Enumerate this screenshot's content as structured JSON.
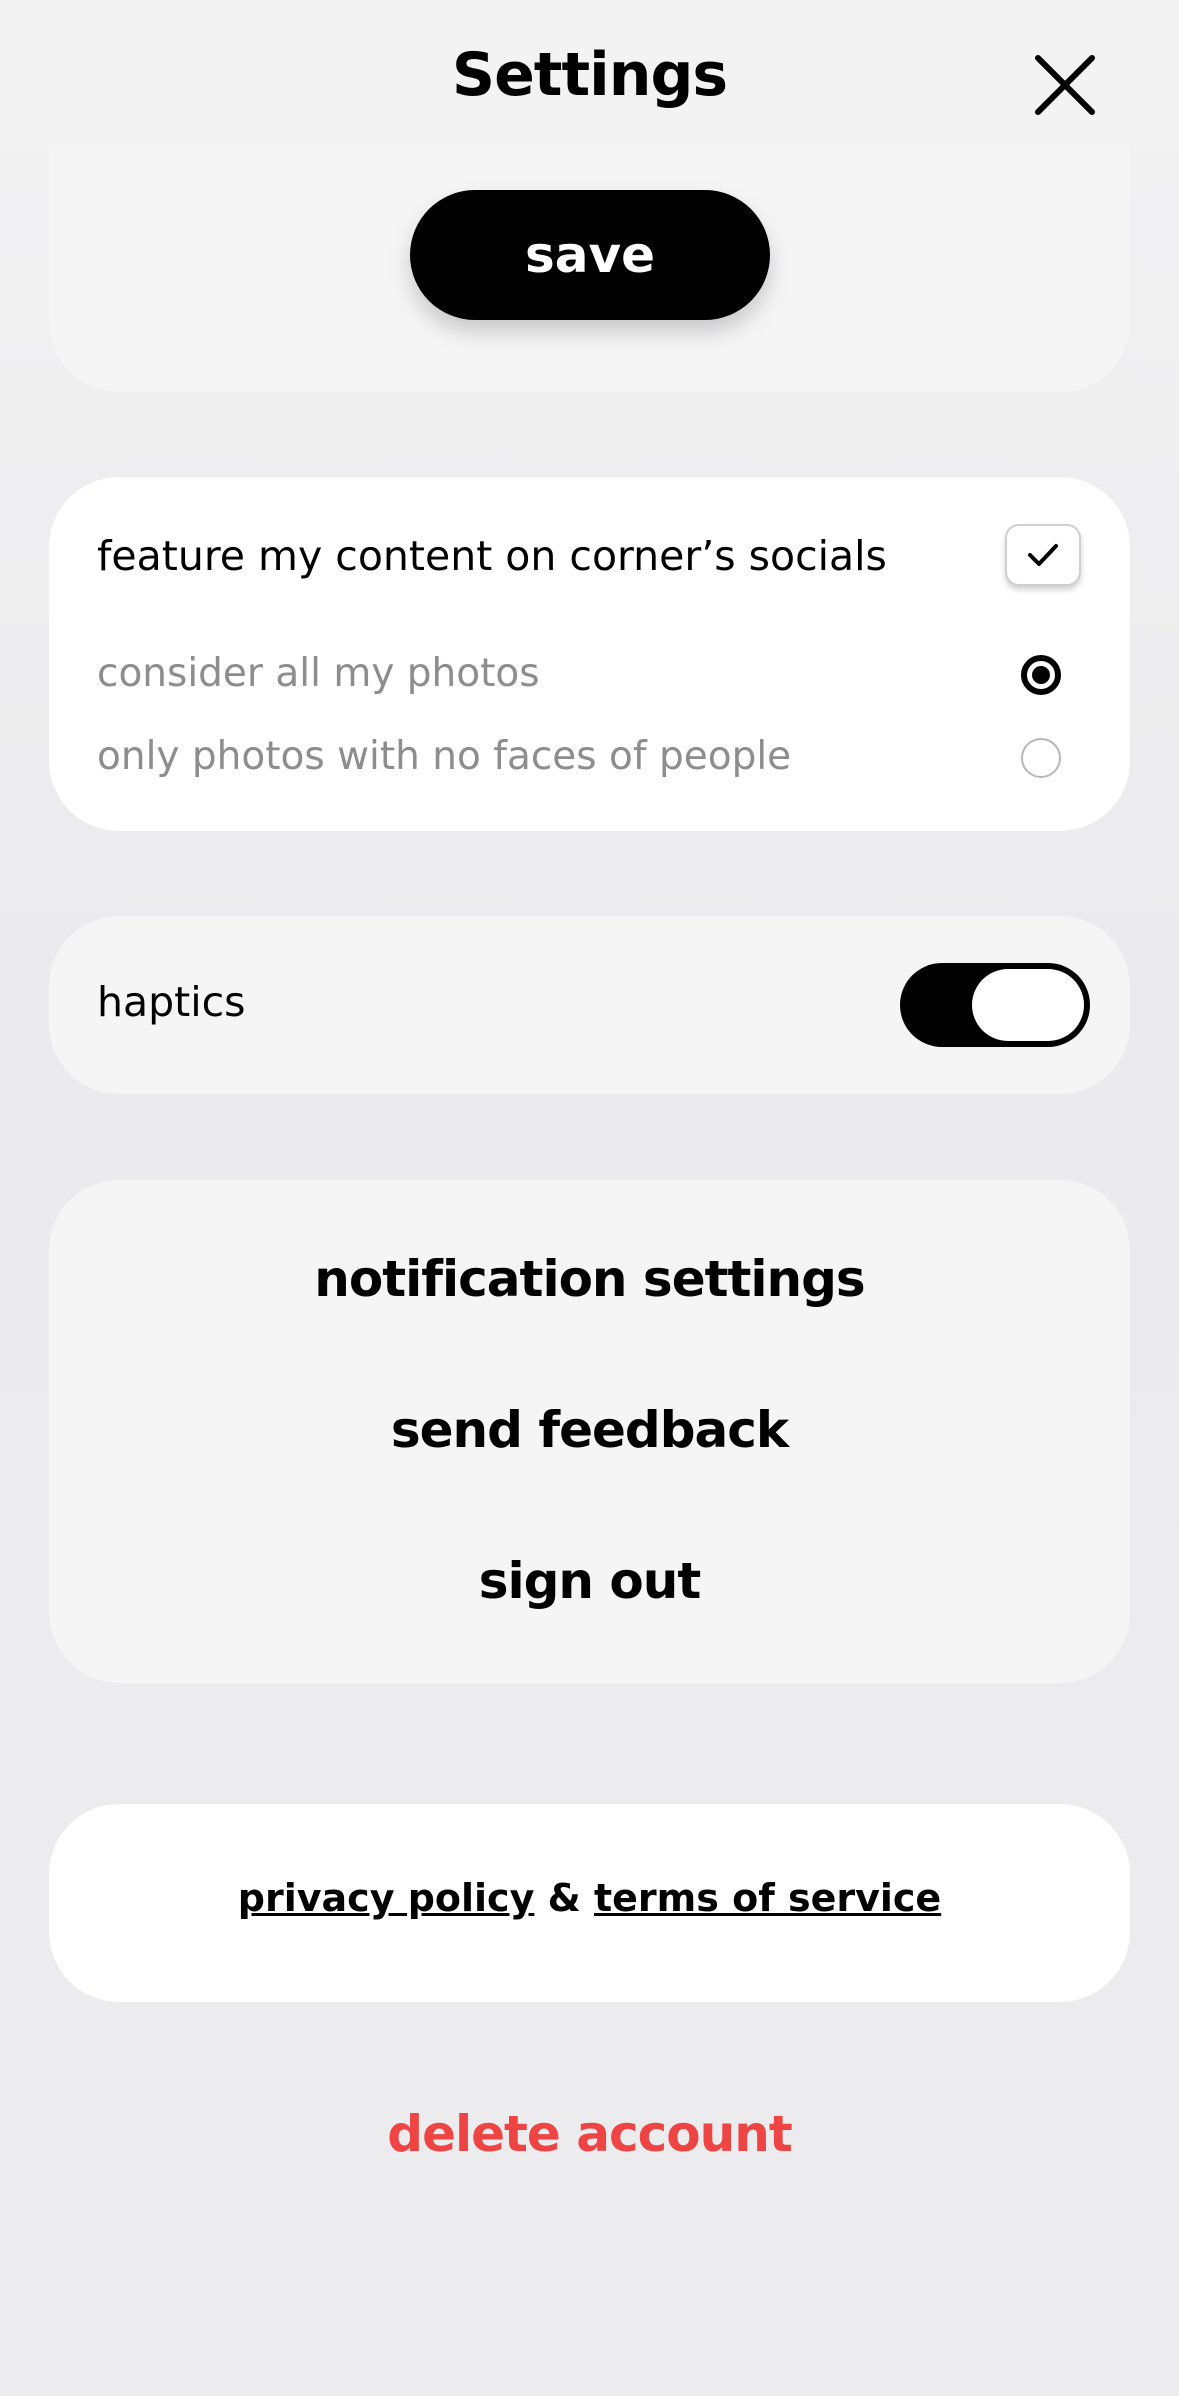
{
  "header": {
    "title": "Settings",
    "close_icon": "close-icon"
  },
  "save_card": {
    "save_label": "save"
  },
  "feature_card": {
    "feature_label": "feature my content on corner’s socials",
    "feature_checked": true,
    "options": [
      {
        "label": "consider all my photos",
        "selected": true
      },
      {
        "label": "only photos with no faces of people",
        "selected": false
      }
    ]
  },
  "haptics_card": {
    "label": "haptics",
    "enabled": true
  },
  "menu": {
    "items": [
      {
        "label": "notification settings"
      },
      {
        "label": "send feedback"
      },
      {
        "label": "sign out"
      }
    ]
  },
  "legal": {
    "privacy_label": "privacy policy",
    "separator": "&",
    "terms_label": "terms of service"
  },
  "delete_label": "delete account",
  "colors": {
    "accent": "#000000",
    "danger": "#ef4444",
    "muted_text": "#8d8d90"
  }
}
